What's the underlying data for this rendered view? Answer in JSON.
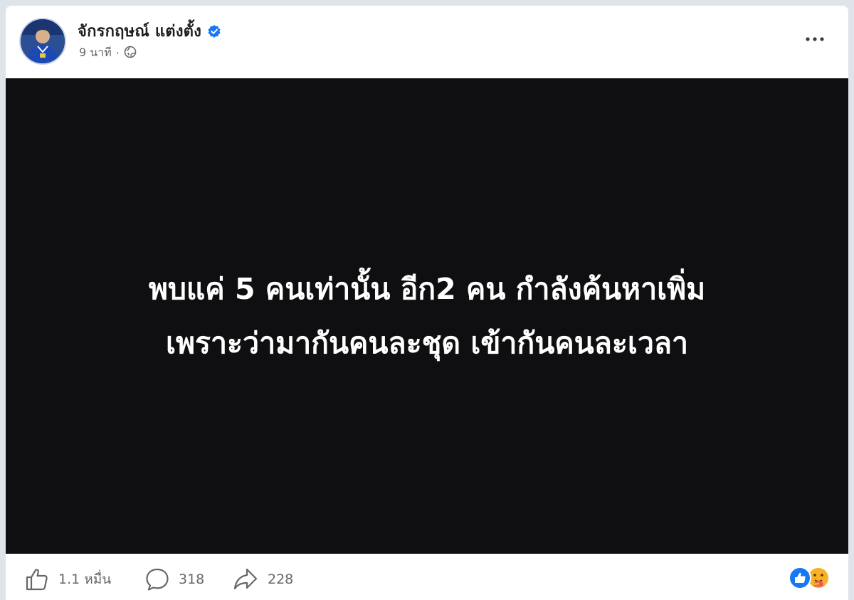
{
  "post": {
    "author": "จักรกฤษณ์ แต่งตั้ง",
    "time": "9 นาที",
    "separator": "·",
    "verified_icon": "verified-badge-icon",
    "privacy_icon": "globe-icon",
    "more_icon": "more-options-icon",
    "media_text": {
      "line1": "พบแค่ 5 คนเท่านั้น อีก2 คน กำลังค้นหาเพิ่ม",
      "line2": "เพราะว่ามากันคนละชุด เข้ากันคนละเวลา"
    },
    "actions": {
      "like_count": "1.1 หมื่น",
      "comment_count": "318",
      "share_count": "228"
    },
    "reaction_icons": [
      "like-reaction-icon",
      "care-reaction-icon"
    ]
  },
  "colors": {
    "background": "#dfe3ea",
    "card": "#ffffff",
    "media_bg": "#0f0f11",
    "accent_blue": "#1877f2",
    "muted_text": "#65676b"
  }
}
